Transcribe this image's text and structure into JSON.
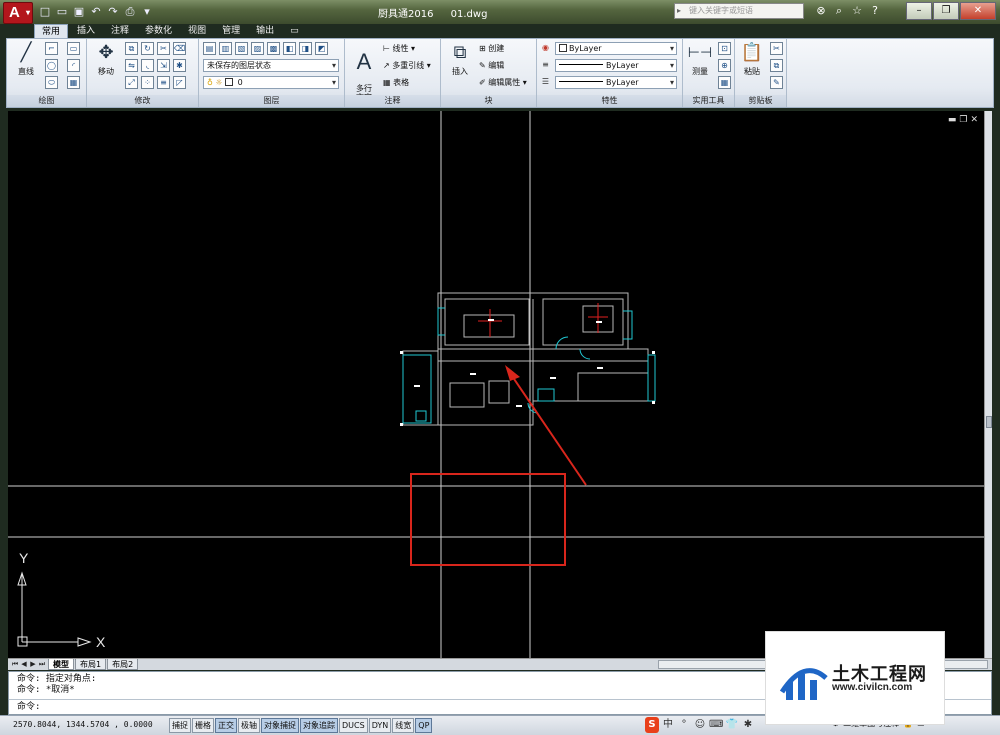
{
  "window": {
    "title_app": "厨具通2016",
    "title_file": "01.dwg",
    "search_placeholder": "键入关键字或短语"
  },
  "ribbon": {
    "tabs": [
      "常用",
      "插入",
      "注释",
      "参数化",
      "视图",
      "管理",
      "输出"
    ],
    "active_tab": "常用",
    "panels": {
      "draw": {
        "label": "绘图",
        "line_label": "直线"
      },
      "modify": {
        "label": "修改",
        "move_label": "移动"
      },
      "layers": {
        "label": "图层",
        "layer_state": "未保存的图层状态",
        "current_layer": "0"
      },
      "annotation": {
        "label": "注释",
        "mtext_label": "多行\n文字",
        "linear_label": "线性",
        "mleader_label": "多重引线",
        "table_label": "表格"
      },
      "block": {
        "label": "块",
        "insert_label": "插入",
        "create_label": "创建",
        "edit_label": "编辑",
        "edit_attr_label": "编辑属性"
      },
      "properties": {
        "label": "特性",
        "color_value": "ByLayer",
        "linetype_value": "ByLayer",
        "lineweight_value": "ByLayer"
      },
      "utilities": {
        "label": "实用工具",
        "measure_label": "测量"
      },
      "clipboard": {
        "label": "剪贴板",
        "paste_label": "粘贴"
      }
    }
  },
  "drawing": {
    "background": "#000000",
    "ucs": {
      "x_label": "X",
      "y_label": "Y"
    },
    "highlight_color": "#d9261c"
  },
  "layout_tabs": [
    "模型",
    "布局1",
    "布局2"
  ],
  "active_layout": "模型",
  "command": {
    "history": [
      "命令: 指定对角点:",
      "命令: *取消*"
    ],
    "prompt": "命令:"
  },
  "status": {
    "coordinates": "2570.8044,  1344.5704 , 0.0000",
    "toggles": [
      {
        "label": "捕捉",
        "on": false
      },
      {
        "label": "栅格",
        "on": false
      },
      {
        "label": "正交",
        "on": true
      },
      {
        "label": "极轴",
        "on": false
      },
      {
        "label": "对象捕捉",
        "on": true
      },
      {
        "label": "对象追踪",
        "on": true
      },
      {
        "label": "DUCS",
        "on": false
      },
      {
        "label": "DYN",
        "on": false
      },
      {
        "label": "线宽",
        "on": false
      },
      {
        "label": "QP",
        "on": true
      }
    ],
    "ime_label": "中",
    "annotation_scale_label": "二维草图与注释"
  },
  "watermark": {
    "title": "土木工程网",
    "url": "www.civilcn.com"
  }
}
